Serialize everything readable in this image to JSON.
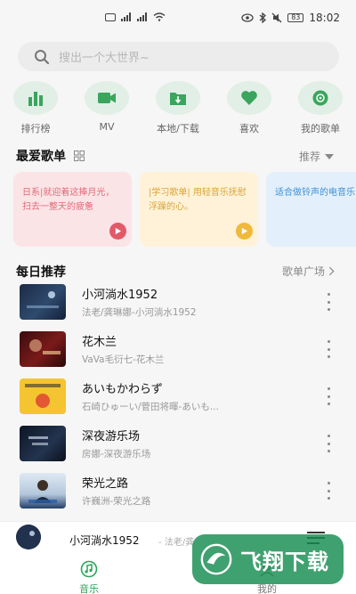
{
  "status_bar": {
    "time": "18:02",
    "battery": "83"
  },
  "search": {
    "placeholder": "搜出一个大世界~"
  },
  "quick_nav": [
    {
      "label": "排行榜",
      "icon": "chart-bars-icon"
    },
    {
      "label": "MV",
      "icon": "video-camera-icon"
    },
    {
      "label": "本地/下载",
      "icon": "download-folder-icon"
    },
    {
      "label": "喜欢",
      "icon": "heart-icon"
    },
    {
      "label": "我的歌单",
      "icon": "disc-icon"
    }
  ],
  "favorites": {
    "title": "最爱歌单",
    "recommend_label": "推荐",
    "cards": [
      {
        "text": "日系|就迎着这捧月光，扫去一整天的疲惫",
        "bg": "#fbe4e6",
        "color": "#e36a79",
        "play_color": "#e25a6a"
      },
      {
        "text": "|学习歌单| 用轻音乐抚慰浮躁的心。",
        "bg": "#fff2d8",
        "color": "#d8a43a",
        "play_color": "#f0b93c"
      },
      {
        "text": "适合做铃声的电音乐",
        "bg": "#e3f0fb",
        "color": "#3d8fd4",
        "play_color": "#3d8fd4"
      }
    ]
  },
  "daily": {
    "title": "每日推荐",
    "more_label": "歌单广场",
    "songs": [
      {
        "title": "小河淌水1952",
        "sub": "法老/龚琳娜-小河淌水1952"
      },
      {
        "title": "花木兰",
        "sub": "VaVa毛衍七-花木兰"
      },
      {
        "title": "あいもかわらず",
        "sub": "石崎ひゅーい/菅田将暉-あいも..."
      },
      {
        "title": "深夜游乐场",
        "sub": "房娜-深夜游乐场"
      },
      {
        "title": "荣光之路",
        "sub": "许巍洲-荣光之路"
      }
    ]
  },
  "mini_player": {
    "title": "小河淌水1952",
    "sub": "- 法老/龚"
  },
  "bottom_nav": [
    {
      "label": "音乐",
      "active": true
    },
    {
      "label": "我的",
      "active": false
    }
  ],
  "watermark": {
    "text": "飞翔下载"
  },
  "colors": {
    "accent": "#2aa55a",
    "icon_circle": "#e1efe6"
  }
}
